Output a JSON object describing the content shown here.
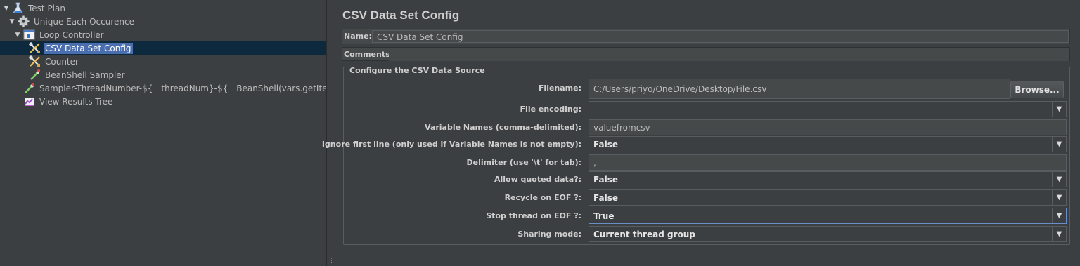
{
  "tree": {
    "items": [
      {
        "label": "Test Plan",
        "icon": "flask-icon"
      },
      {
        "label": "Unique Each Occurence",
        "icon": "gear-icon"
      },
      {
        "label": "Loop Controller",
        "icon": "loop-controller-icon"
      },
      {
        "label": "CSV Data Set Config",
        "icon": "config-tools-icon",
        "selected": true
      },
      {
        "label": "Counter",
        "icon": "config-tools-icon"
      },
      {
        "label": "BeanShell Sampler",
        "icon": "pipette-icon"
      },
      {
        "label": "Sampler-ThreadNumber-${__threadNum}-${__BeanShell(vars.getIteration())}",
        "icon": "pipette-icon"
      },
      {
        "label": "View Results Tree",
        "icon": "chart-icon"
      }
    ]
  },
  "panel": {
    "title": "CSV Data Set Config",
    "name_label": "Name:",
    "name_value": "CSV Data Set Config",
    "comments_label": "Comments:",
    "comments_value": "",
    "group_title": "Configure the CSV Data Source",
    "browse_label": "Browse..."
  },
  "fields": {
    "filename": {
      "label": "Filename:",
      "value": "C:/Users/priyo/OneDrive/Desktop/File.csv"
    },
    "encoding": {
      "label": "File encoding:",
      "value": ""
    },
    "varnames": {
      "label": "Variable Names (comma-delimited):",
      "value": "valuefromcsv"
    },
    "ignore_first": {
      "label": "Ignore first line (only used if Variable Names is not empty):",
      "value": "False"
    },
    "delimiter": {
      "label": "Delimiter (use '\\t' for tab):",
      "value": ","
    },
    "quoted": {
      "label": "Allow quoted data?:",
      "value": "False"
    },
    "recycle": {
      "label": "Recycle on EOF ?:",
      "value": "False"
    },
    "stop_thread": {
      "label": "Stop thread on EOF ?:",
      "value": "True"
    },
    "sharing": {
      "label": "Sharing mode:",
      "value": "Current thread group"
    }
  },
  "colors": {
    "background": "#3c3f41",
    "selection": "#4b6eaf",
    "selection_row": "#0d293e",
    "focus_border": "#6a8fc8"
  }
}
